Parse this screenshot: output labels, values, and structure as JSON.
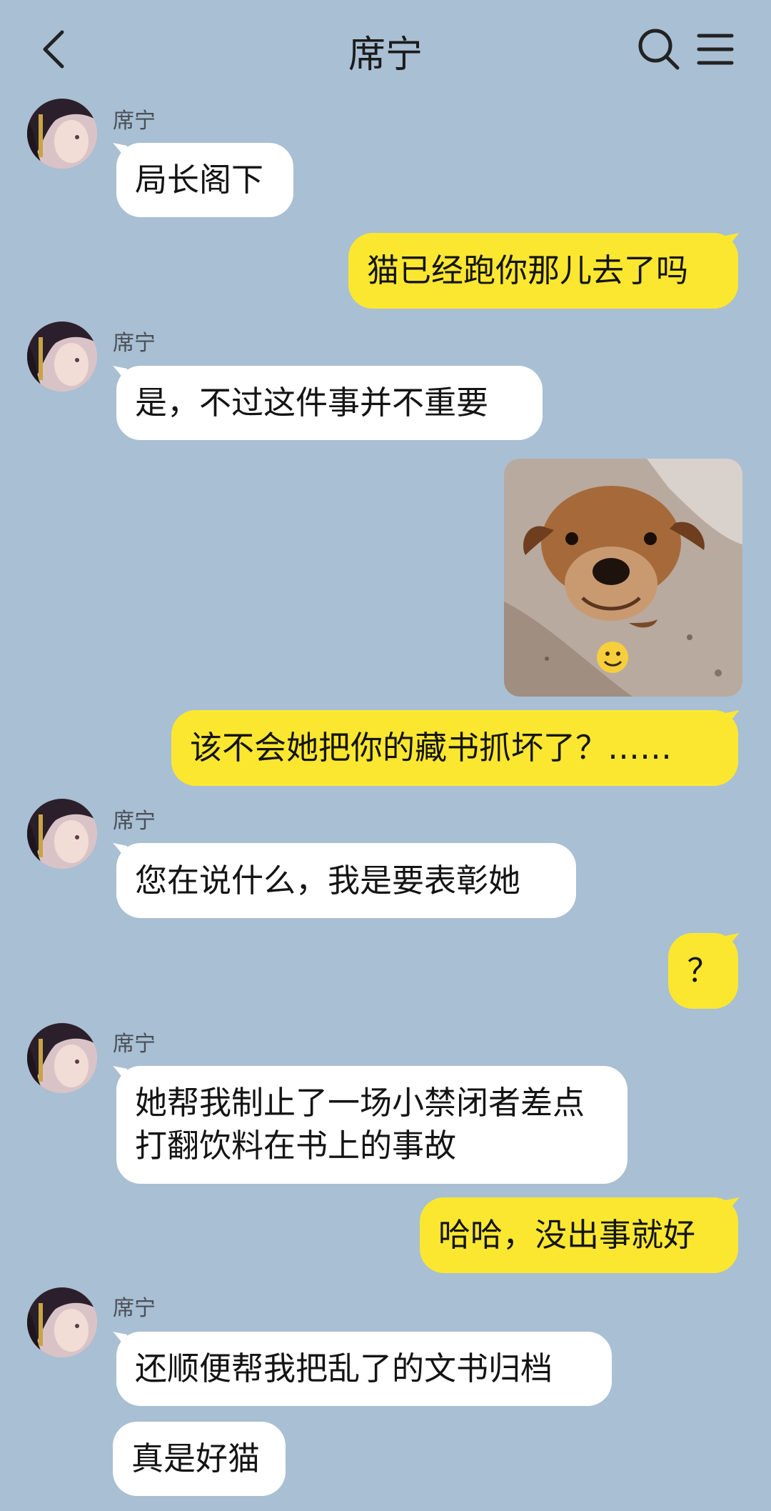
{
  "header": {
    "title": "席宁",
    "back_icon": "chevron-left-icon",
    "search_icon": "search-icon",
    "menu_icon": "hamburger-menu-icon"
  },
  "contact": {
    "name": "席宁"
  },
  "colors": {
    "background": "#a9bfd3",
    "incoming_bubble": "#ffffff",
    "outgoing_bubble": "#fbe730"
  },
  "messages": [
    {
      "side": "in",
      "sender": "席宁",
      "text": "局长阁下"
    },
    {
      "side": "out",
      "text": "猫已经跑你那儿去了吗"
    },
    {
      "side": "in",
      "sender": "席宁",
      "text": "是，不过这件事并不重要"
    },
    {
      "side": "out",
      "type": "image",
      "description_icon": "puppy-smile-sticker"
    },
    {
      "side": "out",
      "text": "该不会她把你的藏书抓坏了？……"
    },
    {
      "side": "in",
      "sender": "席宁",
      "text": "您在说什么，我是要表彰她"
    },
    {
      "side": "out",
      "text": "？"
    },
    {
      "side": "in",
      "sender": "席宁",
      "text": "她帮我制止了一场小禁闭者差点打翻饮料在书上的事故"
    },
    {
      "side": "out",
      "text": "哈哈，没出事就好"
    },
    {
      "side": "in",
      "sender": "席宁",
      "text": "还顺便帮我把乱了的文书归档"
    },
    {
      "side": "in",
      "text": "真是好猫"
    }
  ]
}
